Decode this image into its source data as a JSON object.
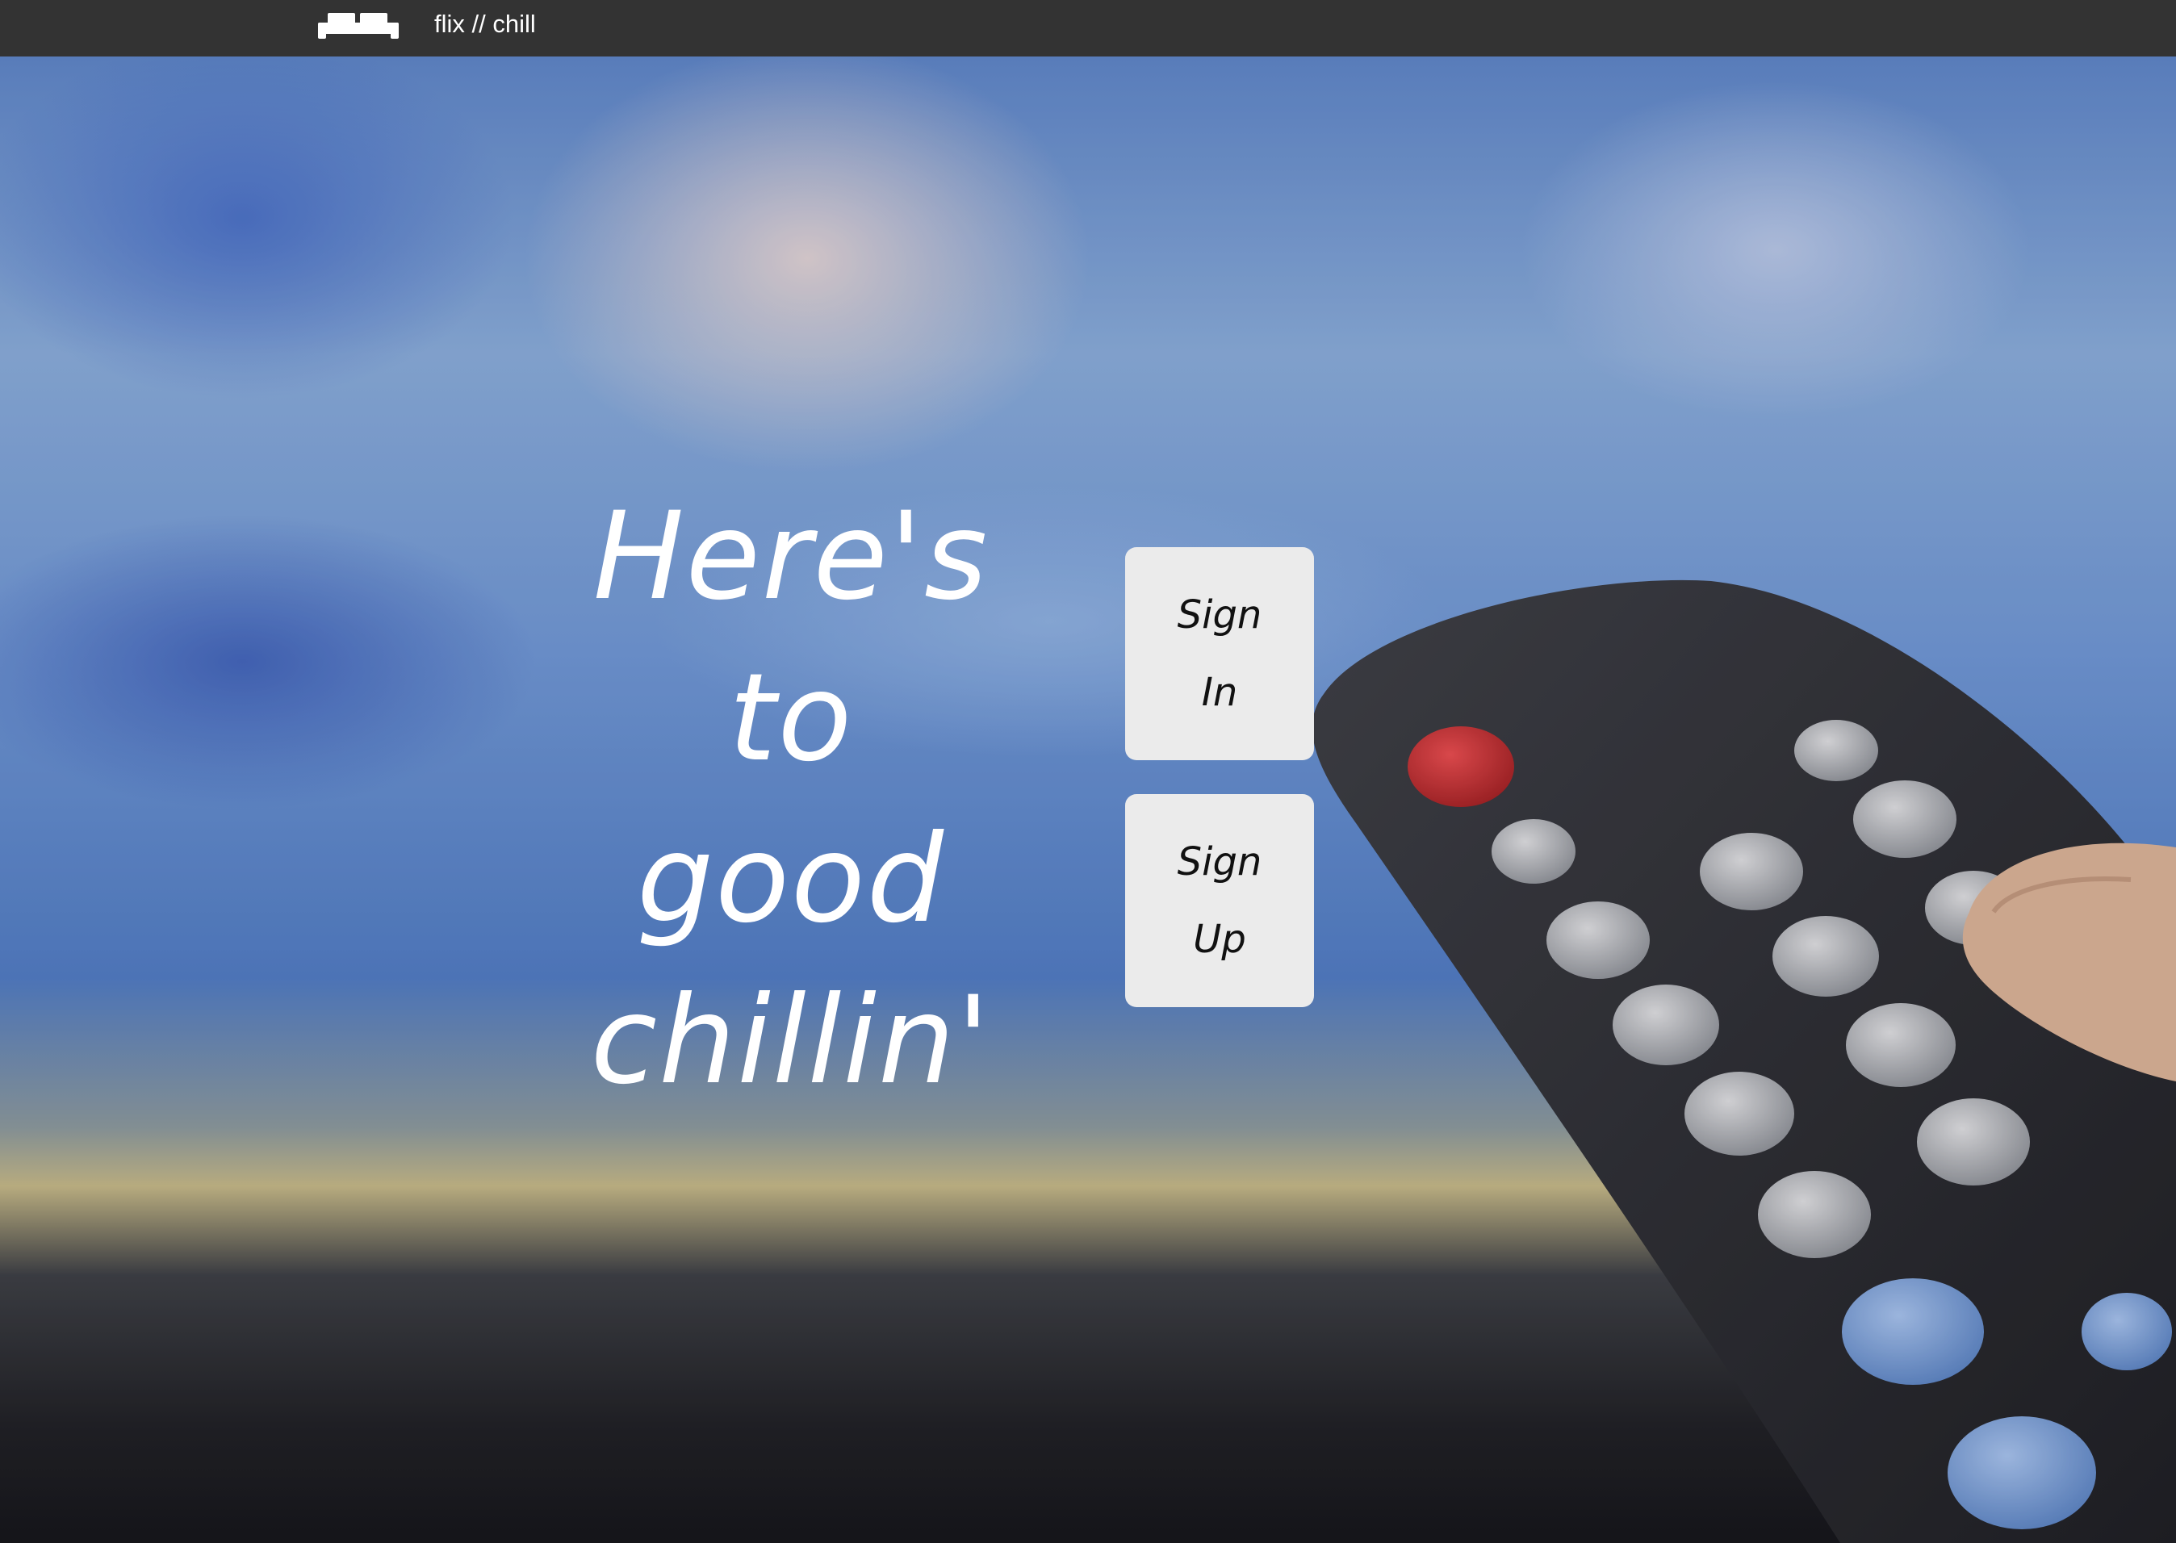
{
  "navbar": {
    "brand_icon": "couch-icon",
    "brand_name": "flix // chill"
  },
  "hero": {
    "background": "blurred-tv-with-remote",
    "tagline_lines": [
      "Here's",
      "to",
      "good",
      "chillin'"
    ]
  },
  "auth": {
    "sign_in": {
      "line1": "Sign",
      "line2": "In"
    },
    "sign_up": {
      "line1": "Sign",
      "line2": "Up"
    }
  },
  "colors": {
    "navbar_bg": "#333333",
    "button_bg": "#ebebeb",
    "text_light": "#ffffff",
    "text_dark": "#111111"
  }
}
